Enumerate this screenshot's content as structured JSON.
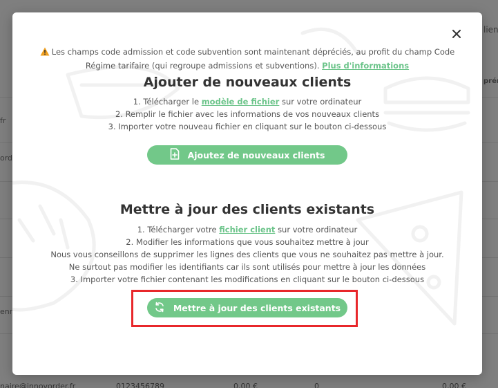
{
  "background": {
    "fragments": [
      "lients",
      "prén",
      "fr",
      "ordo",
      "enno",
      "naire@innovorder.fr",
      "0123456789",
      "0,00 €",
      "0",
      "0,00 €"
    ]
  },
  "modal": {
    "notice": {
      "text": "Les champs code admission et code subvention sont maintenant dépréciés, au profit du champ Code Régime tarifaire (qui regroupe admissions et subventions).",
      "link": "Plus d'informations"
    },
    "add_section": {
      "title": "Ajouter de nouveaux clients",
      "step1_prefix": "1. Télécharger le",
      "step1_link": "modèle de fichier",
      "step1_suffix": "sur votre ordinateur",
      "step2": "2. Remplir le fichier avec les informations de vos nouveaux clients",
      "step3": "3. Importer votre nouveau fichier en cliquant sur le bouton ci-dessous",
      "button_label": "Ajoutez de nouveaux clients"
    },
    "update_section": {
      "title": "Mettre à jour des clients existants",
      "step1_prefix": "1. Télécharger votre",
      "step1_link": "fichier client",
      "step1_suffix": "sur votre ordinateur",
      "step2": "2. Modifier les informations que vous souhaitez mettre à jour",
      "advice1": "Nous vous conseillons de supprimer les lignes des clients que vous ne souhaitez pas mettre à jour.",
      "advice2": "Ne surtout pas modifier les identifiants car ils sont utilisés pour mettre à jour les données",
      "step3": "3. Importer votre fichier contenant les modifications en cliquant sur le bouton ci-dessous",
      "button_label": "Mettre à jour des clients existants"
    },
    "colors": {
      "accent": "#72c889",
      "highlight": "#e8272b",
      "warning": "#f0a020"
    },
    "icons": [
      "close-icon",
      "warning-icon",
      "add-file-icon",
      "refresh-icon"
    ]
  }
}
